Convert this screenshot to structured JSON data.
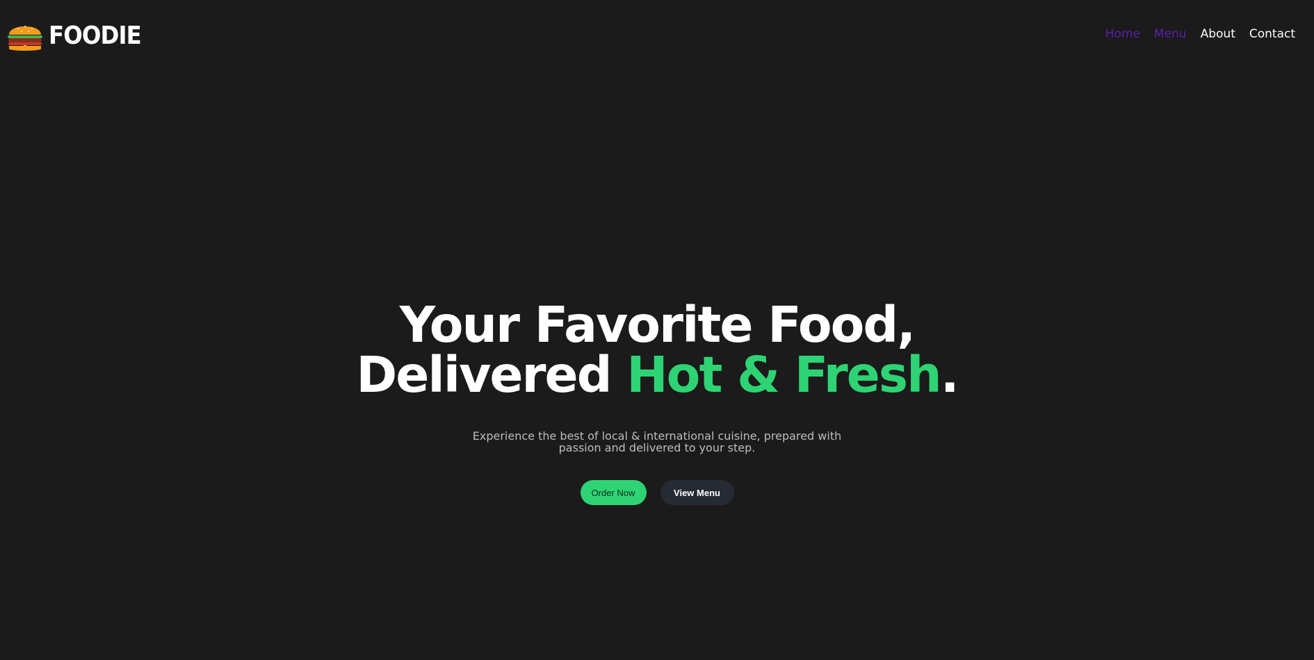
{
  "brand": {
    "logo_icon": "burger-icon",
    "name": "FOODIE"
  },
  "nav": {
    "items": [
      {
        "label": "Home",
        "state": "visited"
      },
      {
        "label": "Menu",
        "state": "visited"
      },
      {
        "label": "About",
        "state": "default"
      },
      {
        "label": "Contact",
        "state": "default"
      }
    ]
  },
  "hero": {
    "line1": "Your Favorite Food,",
    "line2_prefix": "Delivered ",
    "line2_accent": "Hot & Fresh",
    "line2_suffix": ".",
    "subtitle": "Experience the best of local & international cuisine, prepared with passion and delivered to your step.",
    "primary_cta": "Order Now",
    "secondary_cta": "View Menu"
  },
  "colors": {
    "background": "#1b1b1b",
    "accent": "#2ed473",
    "visited_link": "#5a1fae",
    "secondary_button": "#252a33"
  }
}
